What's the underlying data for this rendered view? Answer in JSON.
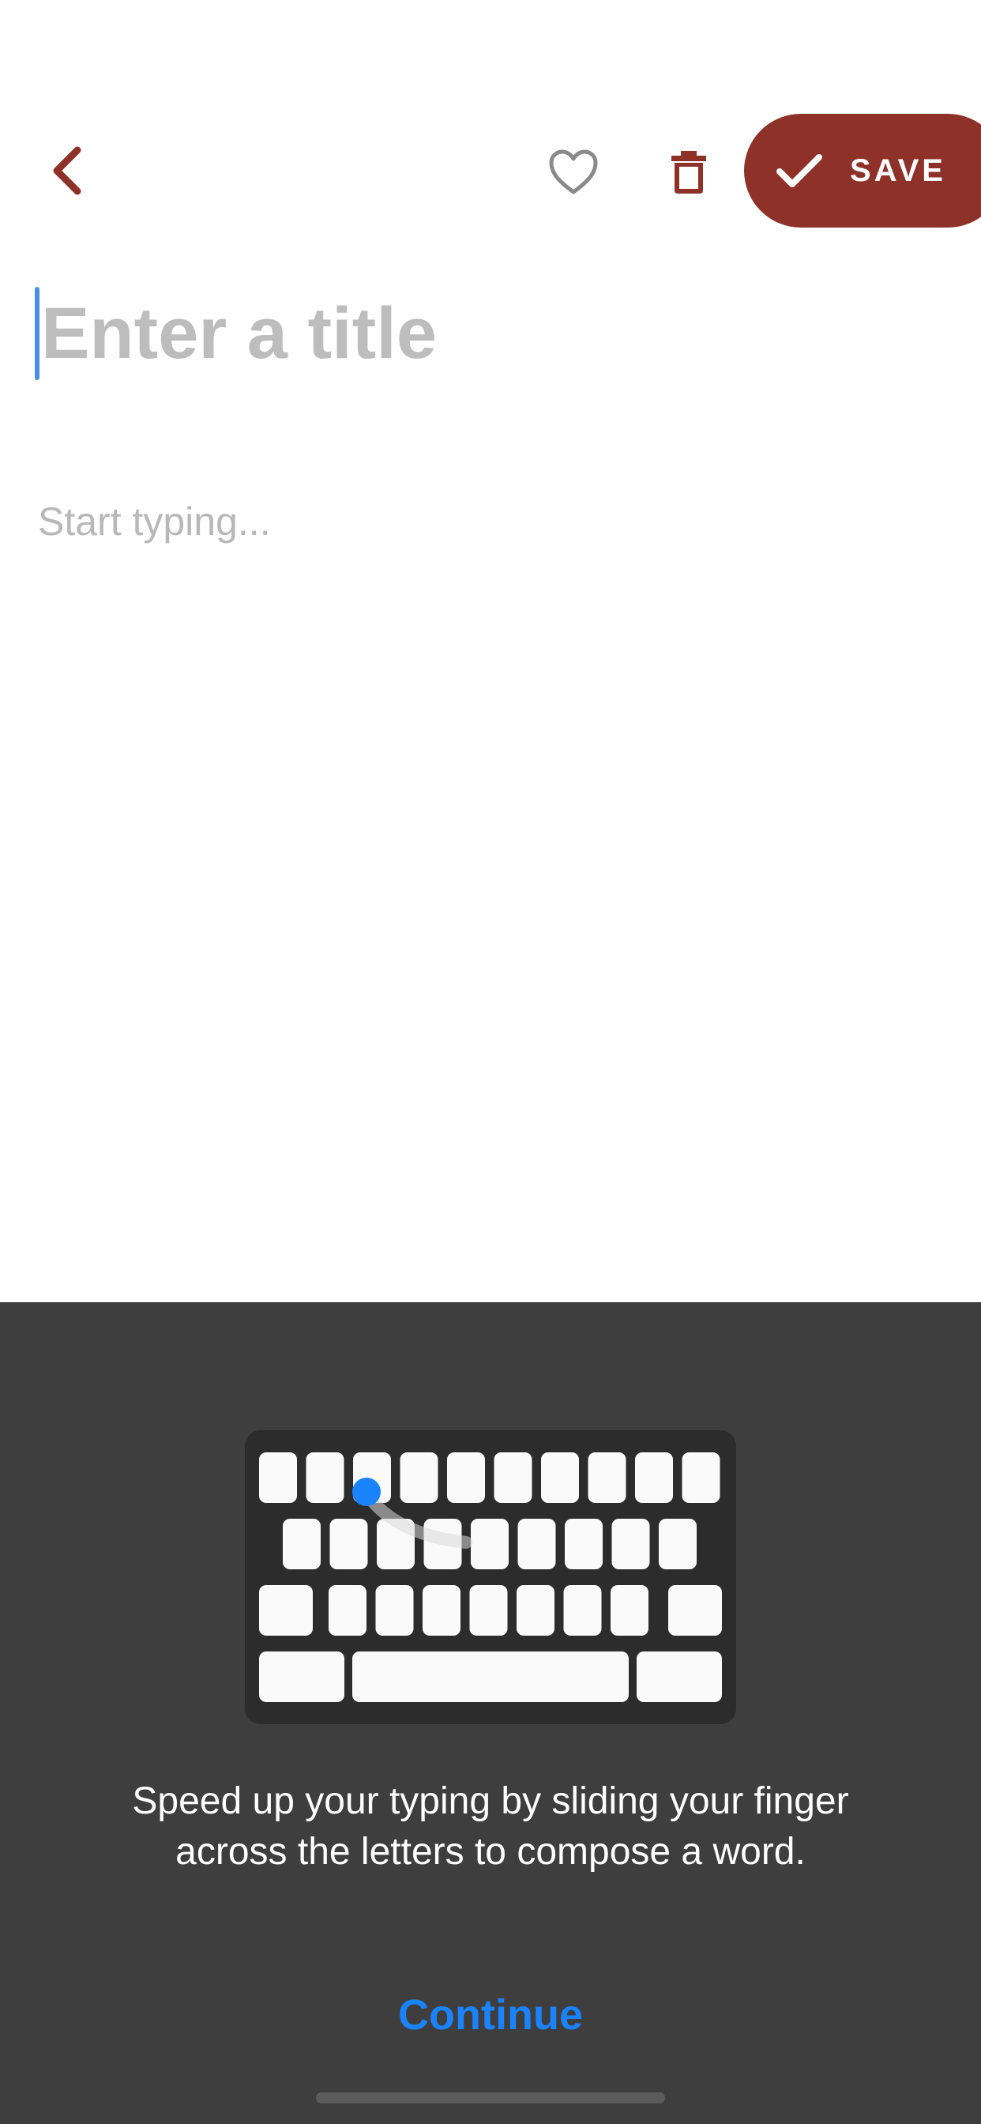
{
  "toolbar": {
    "back_icon": "chevron-left-icon",
    "favorite_icon": "heart-outline-icon",
    "delete_icon": "trash-icon",
    "save_icon": "check-icon",
    "save_label": "SAVE",
    "accent_color": "#8e3229"
  },
  "editor": {
    "title_placeholder": "Enter a title",
    "body_placeholder": "Start typing..."
  },
  "tip_sheet": {
    "illustration": "slide-to-type-keyboard-illustration",
    "message": "Speed up your typing by sliding your finger across the letters to compose a word.",
    "continue_label": "Continue",
    "link_color": "#1a82fb",
    "background_color": "#3e3e3f"
  }
}
